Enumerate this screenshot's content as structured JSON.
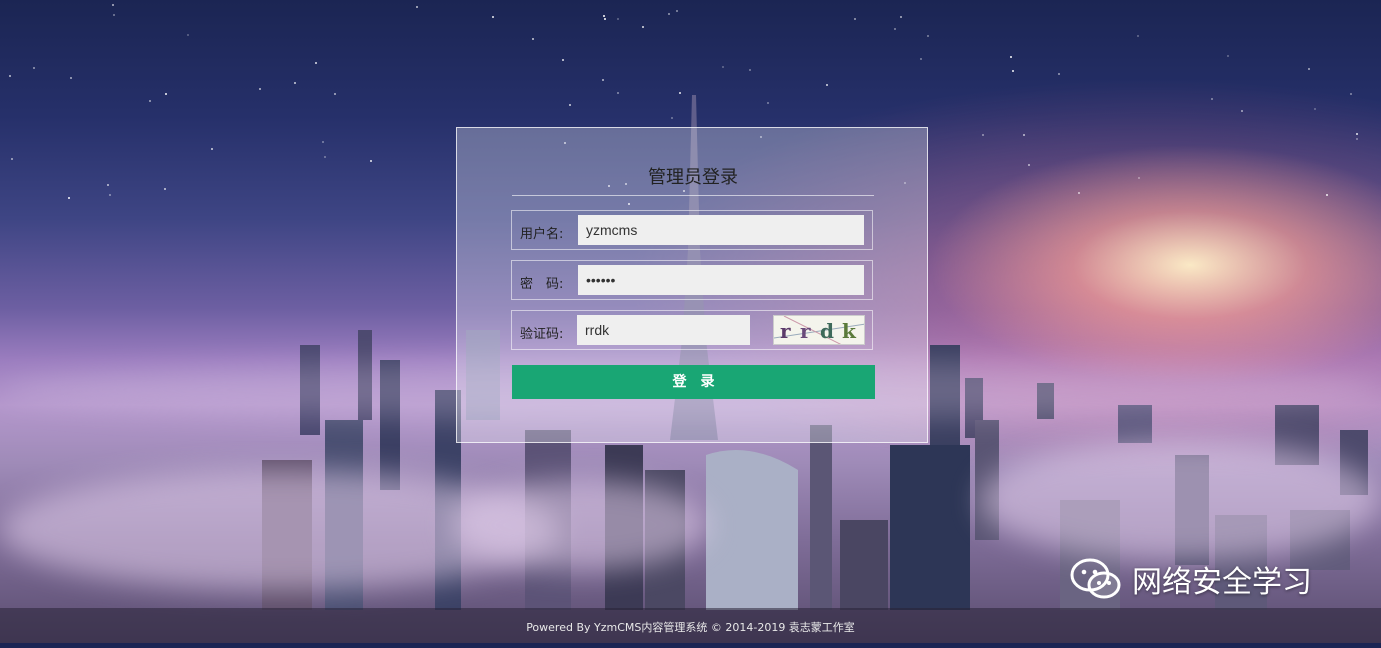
{
  "login": {
    "title": "管理员登录",
    "username_label": "用户名:",
    "username_value": "yzmcms",
    "password_label": "密　码:",
    "password_value": "••••••",
    "captcha_label": "验证码:",
    "captcha_value": "rrdk",
    "captcha_image_text": "rrdk",
    "submit_label": "登录"
  },
  "footer": {
    "text": "Powered By YzmCMS内容管理系统 © 2014-2019 袁志蒙工作室"
  },
  "watermark": {
    "text": "网络安全学习",
    "icon": "wechat-icon"
  },
  "colors": {
    "button": "#19a674",
    "footer_bg": "rgba(40,35,55,0.55)"
  }
}
